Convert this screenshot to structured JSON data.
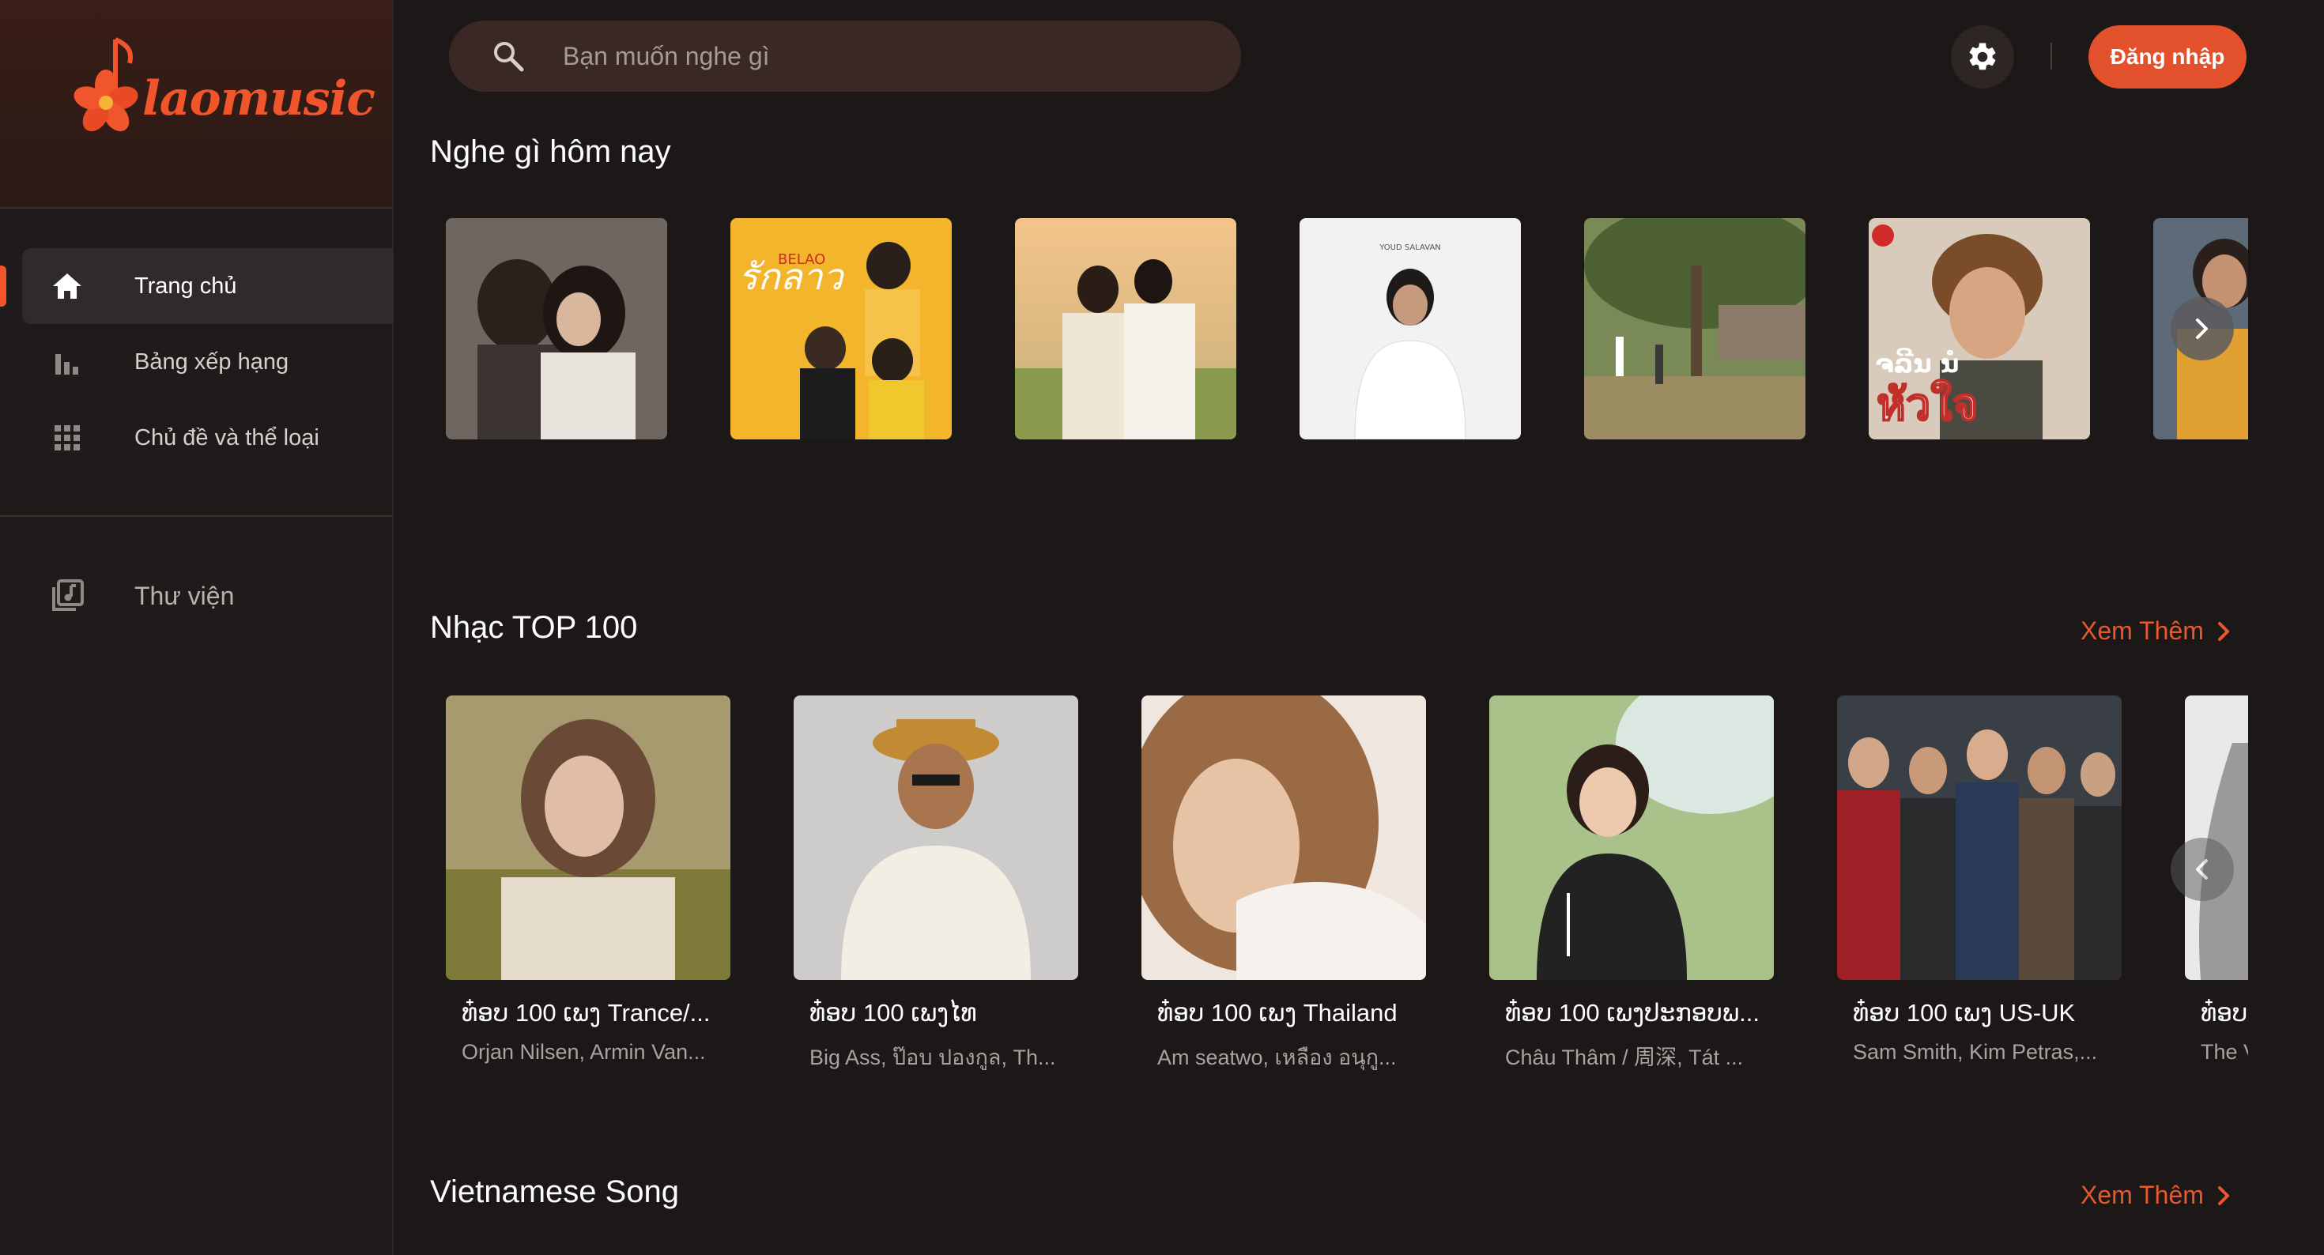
{
  "app": {
    "logo_text": "laomusic",
    "brand_color": "#f0552c"
  },
  "sidebar": {
    "items": [
      {
        "label": "Trang chủ",
        "icon": "home-icon",
        "active": true
      },
      {
        "label": "Bảng xếp hạng",
        "icon": "chart-bar-icon",
        "active": false
      },
      {
        "label": "Chủ đề và thể loại",
        "icon": "grid-icon",
        "active": false
      }
    ],
    "library": {
      "label": "Thư viện",
      "icon": "music-library-icon"
    }
  },
  "header": {
    "search_placeholder": "Bạn muốn nghe gì",
    "login_label": "Đăng nhập"
  },
  "sections": {
    "today": {
      "title": "Nghe gì hôm nay",
      "cards": [
        {
          "art_text": ""
        },
        {
          "art_text": "BELAO"
        },
        {
          "art_text": ""
        },
        {
          "art_text": "YOUD SALAVAN"
        },
        {
          "art_text": ""
        },
        {
          "art_text": "ຈລີນ ນໍ"
        },
        {
          "art_text": ""
        }
      ]
    },
    "top100": {
      "title": "Nhạc TOP 100",
      "see_more": "Xem Thêm",
      "cards": [
        {
          "title": "ທ໋ອບ 100 ເພງ Trance/...",
          "subtitle": "Orjan Nilsen, Armin Van..."
        },
        {
          "title": "ທ໋ອບ 100 ເພງໄທ",
          "subtitle": "Big Ass, ป๊อบ ปองกูล, Th..."
        },
        {
          "title": "ທ໋ອບ 100 ເພງ Thailand",
          "subtitle": "Am seatwo, เหลือง อนุกู..."
        },
        {
          "title": "ທ໋ອບ 100 ເພງປະກອບພ...",
          "subtitle": "Châu Thâm / 周深, Tát ..."
        },
        {
          "title": "ທ໋ອບ 100 ເພງ US-UK",
          "subtitle": "Sam Smith, Kim Petras,..."
        },
        {
          "title": "ທ໋ອບ",
          "subtitle": "The V"
        }
      ]
    },
    "vietnamese": {
      "title": "Vietnamese Song",
      "see_more": "Xem Thêm"
    }
  }
}
